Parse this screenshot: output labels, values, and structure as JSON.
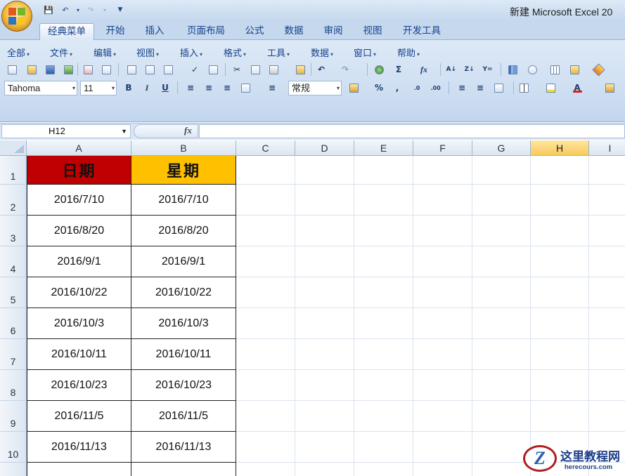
{
  "window": {
    "title": "新建 Microsoft Excel 20"
  },
  "ribbon_tabs": [
    "经典菜单",
    "开始",
    "插入",
    "页面布局",
    "公式",
    "数据",
    "审阅",
    "视图",
    "开发工具"
  ],
  "active_tab": "经典菜单",
  "classic_menu": [
    "全部",
    "文件",
    "编辑",
    "视图",
    "插入",
    "格式",
    "工具",
    "数据",
    "窗口",
    "帮助"
  ],
  "format": {
    "font_name": "Tahoma",
    "font_size": "11",
    "bold": "B",
    "italic": "I",
    "underline": "U",
    "number_format": "常规",
    "percent": "%",
    "comma": ","
  },
  "formula_bar": {
    "name_box": "H12",
    "fx": "fx",
    "content": ""
  },
  "columns": [
    "A",
    "B",
    "C",
    "D",
    "E",
    "F",
    "G",
    "H",
    "I"
  ],
  "selected_column": "H",
  "rows": [
    "1",
    "2",
    "3",
    "4",
    "5",
    "6",
    "7",
    "8",
    "9",
    "10"
  ],
  "sheet": {
    "header": {
      "a": "日期",
      "b": "星期",
      "a_fill": "#c00000",
      "b_fill": "#ffc000"
    },
    "data": [
      {
        "a": "2016/7/10",
        "b": "2016/7/10"
      },
      {
        "a": "2016/8/20",
        "b": "2016/8/20"
      },
      {
        "a": "2016/9/1",
        "b": "2016/9/1"
      },
      {
        "a": "2016/10/22",
        "b": "2016/10/22"
      },
      {
        "a": "2016/10/3",
        "b": "2016/10/3"
      },
      {
        "a": "2016/10/11",
        "b": "2016/10/11"
      },
      {
        "a": "2016/10/23",
        "b": "2016/10/23"
      },
      {
        "a": "2016/11/5",
        "b": "2016/11/5"
      },
      {
        "a": "2016/11/13",
        "b": "2016/11/13"
      }
    ]
  },
  "watermark": {
    "letter": "Z",
    "title": "这里教程网",
    "sub": "herecours.com"
  }
}
